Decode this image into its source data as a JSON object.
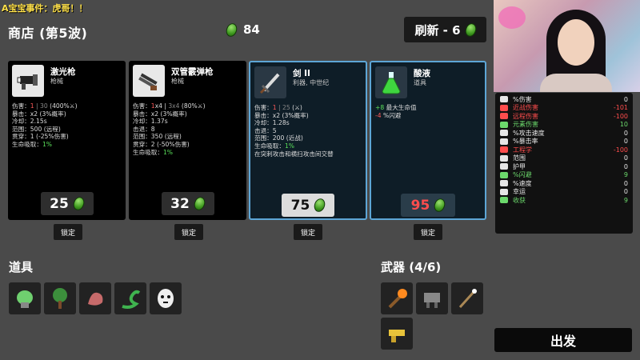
{
  "banner": "A宝宝事件：虎哥！！",
  "header": {
    "title": "商店 (第5波)",
    "materials": "84",
    "refresh_label": "刷新 - 6"
  },
  "cards": [
    {
      "name": "激光枪",
      "class": "枪械",
      "stats": [
        {
          "label": "伤害：",
          "parts": [
            {
              "t": "1",
              "c": "r"
            },
            {
              "t": " | ",
              "c": "d"
            },
            {
              "t": "30",
              "c": "d"
            },
            {
              "t": " (400%⚔)",
              "c": ""
            }
          ]
        },
        {
          "label": "暴击：x2 (3%概率)"
        },
        {
          "label": "冷却：2.15s"
        },
        {
          "label": "范围：500 (远程)"
        },
        {
          "label": "贯穿：1 (-25%伤害)"
        },
        {
          "label": "生命吸取：",
          "parts": [
            {
              "t": "1%",
              "c": "g"
            }
          ]
        }
      ],
      "price": "25",
      "lock": "锁定"
    },
    {
      "name": "双管霰弹枪",
      "class": "枪械",
      "stats": [
        {
          "label": "伤害：",
          "parts": [
            {
              "t": "1",
              "c": "r"
            },
            {
              "t": "x4 | ",
              "c": ""
            },
            {
              "t": "3x4",
              "c": "d"
            },
            {
              "t": " (80%⚔)",
              "c": ""
            }
          ]
        },
        {
          "label": "暴击：x2 (3%概率)"
        },
        {
          "label": "冷却：1.37s"
        },
        {
          "label": "击退：8"
        },
        {
          "label": "范围：350 (远程)"
        },
        {
          "label": "贯穿：2 (-50%伤害)"
        },
        {
          "label": "生命吸取：",
          "parts": [
            {
              "t": "1%",
              "c": "g"
            }
          ]
        }
      ],
      "price": "32",
      "lock": "锁定"
    },
    {
      "name": "剑 II",
      "class": "利器, 中世纪",
      "stats": [
        {
          "label": "伤害：",
          "parts": [
            {
              "t": "1",
              "c": "r"
            },
            {
              "t": " | ",
              "c": "d"
            },
            {
              "t": "25",
              "c": "d"
            },
            {
              "t": " (⚔)",
              "c": ""
            }
          ]
        },
        {
          "label": "暴击：x2 (3%概率)"
        },
        {
          "label": "冷却：1.28s"
        },
        {
          "label": "击退：5"
        },
        {
          "label": "范围：200 (近战)"
        },
        {
          "label": "生命吸取：",
          "parts": [
            {
              "t": "1%",
              "c": "g"
            }
          ]
        },
        {
          "label": "在突刺攻击和横扫攻击间交替"
        }
      ],
      "price": "75",
      "lock": "锁定"
    },
    {
      "name": "酸液",
      "class": "道具",
      "stats": [
        {
          "label": "",
          "parts": [
            {
              "t": "+8",
              "c": "g"
            },
            {
              "t": " 最大生命值",
              "c": ""
            }
          ]
        },
        {
          "label": "",
          "parts": [
            {
              "t": "-4",
              "c": "r"
            },
            {
              "t": " %闪避",
              "c": ""
            }
          ]
        }
      ],
      "price": "95",
      "lock": "锁定"
    }
  ],
  "items_section": {
    "label": "道具"
  },
  "weapons_section": {
    "label": "武器 (4/6)"
  },
  "stat_rows": [
    {
      "label": "%伤害",
      "value": "0",
      "color": "#e6e6e6"
    },
    {
      "label": "近战伤害",
      "value": "-101",
      "color": "#ff4d4d"
    },
    {
      "label": "远程伤害",
      "value": "-100",
      "color": "#ff4d4d"
    },
    {
      "label": "元素伤害",
      "value": "10",
      "color": "#6cd96c"
    },
    {
      "label": "%攻击速度",
      "value": "0",
      "color": "#e6e6e6"
    },
    {
      "label": "%暴击率",
      "value": "0",
      "color": "#e6e6e6"
    },
    {
      "label": "工程学",
      "value": "-100",
      "color": "#ff4d4d"
    },
    {
      "label": "范围",
      "value": "0",
      "color": "#e6e6e6"
    },
    {
      "label": "护甲",
      "value": "0",
      "color": "#e6e6e6"
    },
    {
      "label": "%闪避",
      "value": "9",
      "color": "#6cd96c"
    },
    {
      "label": "%速度",
      "value": "0",
      "color": "#e6e6e6"
    },
    {
      "label": "幸运",
      "value": "0",
      "color": "#e6e6e6"
    },
    {
      "label": "收获",
      "value": "9",
      "color": "#6cd96c"
    }
  ],
  "depart_label": "出发",
  "icons": {
    "items": [
      "brain-coral-icon",
      "tree-icon",
      "fleshy-hand-icon",
      "snake-icon",
      "mask-icon"
    ],
    "weapons": [
      "torch-icon",
      "turret-icon",
      "wand-icon",
      "brass-knuckles-icon"
    ]
  }
}
